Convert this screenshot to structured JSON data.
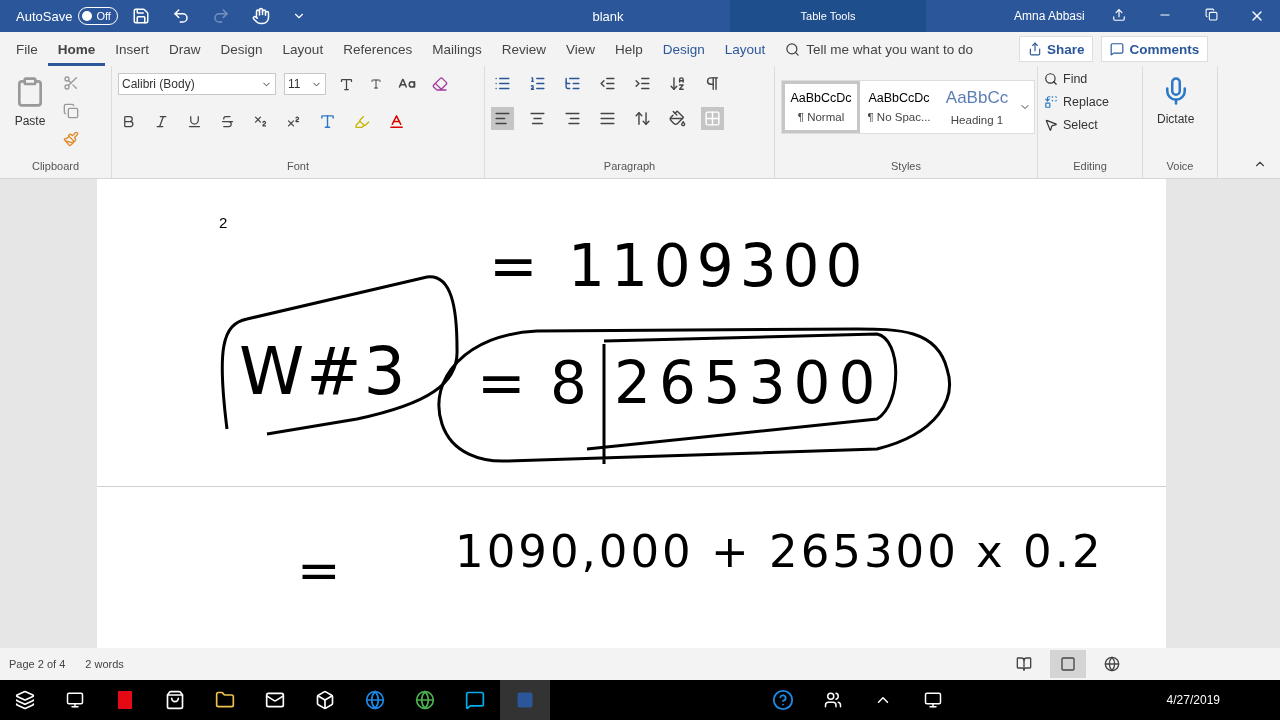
{
  "title_bar": {
    "autosave_label": "AutoSave",
    "autosave_toggle": {
      "label": "Off",
      "on": false
    },
    "document_title": "blank",
    "contextual_label": "Table Tools",
    "user": "Amna Abbasi"
  },
  "menu_tabs": [
    {
      "label": "File",
      "selected": false,
      "kind": "normal"
    },
    {
      "label": "Home",
      "selected": true,
      "kind": "normal"
    },
    {
      "label": "Insert",
      "selected": false,
      "kind": "normal"
    },
    {
      "label": "Draw",
      "selected": false,
      "kind": "normal"
    },
    {
      "label": "Design",
      "selected": false,
      "kind": "normal"
    },
    {
      "label": "Layout",
      "selected": false,
      "kind": "normal"
    },
    {
      "label": "References",
      "selected": false,
      "kind": "normal"
    },
    {
      "label": "Mailings",
      "selected": false,
      "kind": "normal"
    },
    {
      "label": "Review",
      "selected": false,
      "kind": "normal"
    },
    {
      "label": "View",
      "selected": false,
      "kind": "normal"
    },
    {
      "label": "Help",
      "selected": false,
      "kind": "normal"
    },
    {
      "label": "Design",
      "selected": false,
      "kind": "contextual"
    },
    {
      "label": "Layout",
      "selected": false,
      "kind": "contextual"
    }
  ],
  "tell_me": {
    "placeholder": "Tell me what you want to do"
  },
  "share_button": "Share",
  "comments_button": "Comments",
  "ribbon": {
    "clipboard": {
      "paste": "Paste",
      "label": "Clipboard"
    },
    "font": {
      "font_name": "Calibri (Body)",
      "font_size": "11",
      "label": "Font"
    },
    "paragraph": {
      "label": "Paragraph",
      "alignment_buttons": [
        {
          "selected": true
        },
        {
          "selected": false
        },
        {
          "selected": false
        },
        {
          "selected": false
        }
      ]
    },
    "styles": {
      "label": "Styles",
      "items": [
        {
          "preview": "AaBbCcDc",
          "name": "¶ Normal",
          "selected": true,
          "kind": "body"
        },
        {
          "preview": "AaBbCcDc",
          "name": "¶ No Spac...",
          "selected": false,
          "kind": "body"
        },
        {
          "preview": "AaBbCc",
          "name": "Heading 1",
          "selected": false,
          "kind": "heading"
        }
      ]
    },
    "editing": {
      "find": "Find",
      "replace": "Replace",
      "select": "Select",
      "label": "Editing"
    },
    "voice": {
      "dictate": "Dictate",
      "label": "Voice"
    }
  },
  "document": {
    "page_text": "2",
    "ink": [
      "= 1109300",
      "W#3",
      "= 8",
      "265300",
      "=",
      "1090,000 + 265300 x 0.2"
    ]
  },
  "status_bar": {
    "page": "Page 2 of 4",
    "words": "2 words",
    "view_buttons": [
      {
        "selected": false
      },
      {
        "selected": true
      },
      {
        "selected": false
      }
    ]
  },
  "taskbar": {
    "date": "4/27/2019"
  }
}
